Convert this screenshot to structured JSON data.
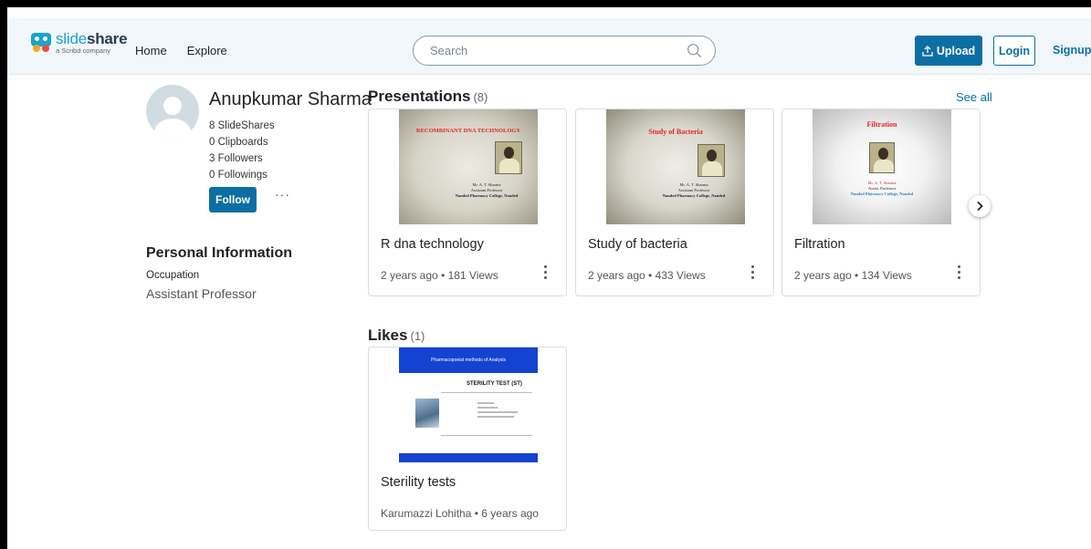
{
  "header": {
    "logo": {
      "brand_light": "slide",
      "brand_bold": "share",
      "tagline": "a Scribd company"
    },
    "nav": [
      "Home",
      "Explore"
    ],
    "search": {
      "placeholder": "Search",
      "value": ""
    },
    "upload_label": "Upload",
    "login_label": "Login",
    "signup_label": "Signup"
  },
  "profile": {
    "name": "Anupkumar Sharma",
    "stats": [
      "8 SlideShares",
      "0 Clipboards",
      "3 Followers",
      "0 Followings"
    ],
    "follow_label": "Follow",
    "more_label": "···",
    "personal_info": {
      "title": "Personal Information",
      "label": "Occupation",
      "value": "Assistant Professor"
    }
  },
  "presentations": {
    "title": "Presentations",
    "count": "(8)",
    "see_all": "See all",
    "items": [
      {
        "title": "R dna technology",
        "meta": "2 years ago • 181 Views",
        "thumb": {
          "heading": "RECOMBINANT DNA TECHNOLOGY",
          "lines": [
            "Mr. A. T. Sharma",
            "Assistant Professor",
            "Nanded Pharmacy College, Nanded"
          ]
        }
      },
      {
        "title": "Study of bacteria",
        "meta": "2 years ago • 433 Views",
        "thumb": {
          "heading": "Study of Bacteria",
          "lines": [
            "Mr. A. T. Sharma",
            "Assistant Professor",
            "Nanded Pharmacy College, Nanded"
          ]
        }
      },
      {
        "title": "Filtration",
        "meta": "2 years ago • 134 Views",
        "thumb": {
          "heading": "Filtration",
          "lines": [
            "Mr. A. T. Sharma",
            "Assist. Professor",
            "Nanded Pharmacy College, Nanded"
          ]
        }
      }
    ]
  },
  "likes": {
    "title": "Likes",
    "count": "(1)",
    "items": [
      {
        "title": "Sterility tests",
        "meta": "Karumazzi Lohitha • 6 years ago",
        "thumb": {
          "banner": "Pharmacopoeial methods of Analysis",
          "heading": "STERILITY TEST (ST)"
        }
      }
    ]
  },
  "colors": {
    "accent": "#0b6fa4",
    "header_bg": "#f1f7fa",
    "slide_title": "#dd2222",
    "likes_banner": "#1543d1"
  },
  "icons": [
    "search-icon",
    "upload-icon",
    "kebab-menu-icon",
    "chevron-right-icon",
    "user-avatar-icon"
  ]
}
